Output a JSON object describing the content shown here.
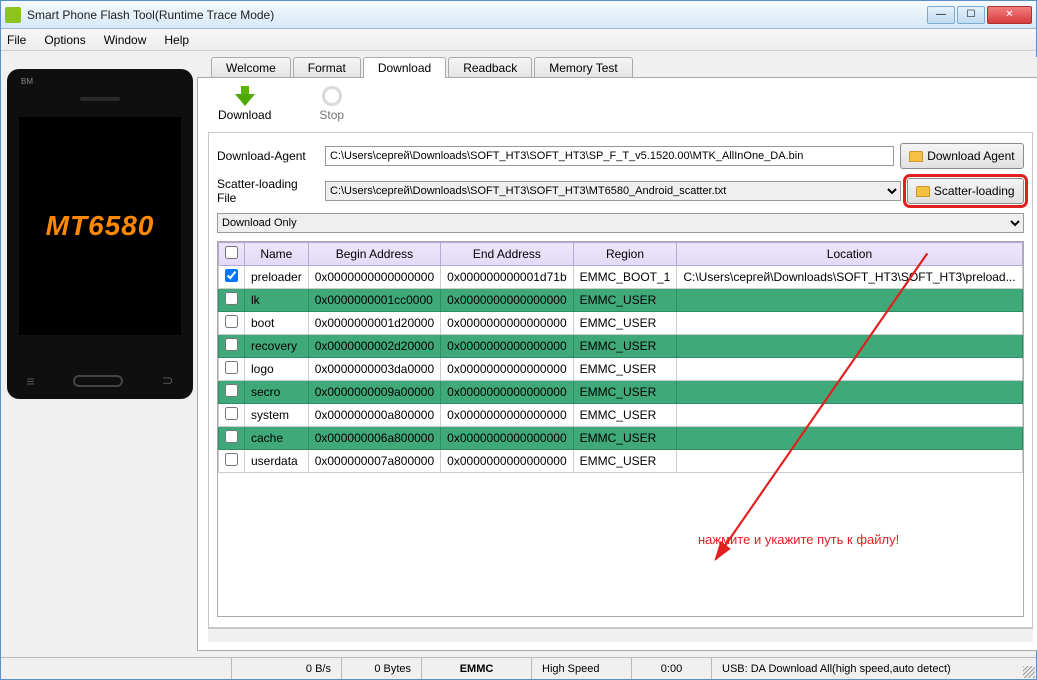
{
  "window": {
    "title": "Smart Phone Flash Tool(Runtime Trace Mode)"
  },
  "menu": {
    "file": "File",
    "options": "Options",
    "window": "Window",
    "help": "Help"
  },
  "phone": {
    "brand": "BM",
    "model": "MT6580"
  },
  "tabs": {
    "welcome": "Welcome",
    "format": "Format",
    "download": "Download",
    "readback": "Readback",
    "memorytest": "Memory Test"
  },
  "toolbar": {
    "download": "Download",
    "stop": "Stop"
  },
  "form": {
    "da_label": "Download-Agent",
    "da_value": "C:\\Users\\сергей\\Downloads\\SOFT_HT3\\SOFT_HT3\\SP_F_T_v5.1520.00\\MTK_AllInOne_DA.bin",
    "da_btn": "Download Agent",
    "scatter_label": "Scatter-loading File",
    "scatter_value": "C:\\Users\\сергей\\Downloads\\SOFT_HT3\\SOFT_HT3\\MT6580_Android_scatter.txt",
    "scatter_btn": "Scatter-loading",
    "mode": "Download Only"
  },
  "table": {
    "headers": {
      "name": "Name",
      "begin": "Begin Address",
      "end": "End Address",
      "region": "Region",
      "location": "Location"
    },
    "rows": [
      {
        "checked": true,
        "sel": false,
        "name": "preloader",
        "begin": "0x0000000000000000",
        "end": "0x000000000001d71b",
        "region": "EMMC_BOOT_1",
        "location": "C:\\Users\\сергей\\Downloads\\SOFT_HT3\\SOFT_HT3\\preload..."
      },
      {
        "checked": false,
        "sel": true,
        "name": "lk",
        "begin": "0x0000000001cc0000",
        "end": "0x0000000000000000",
        "region": "EMMC_USER",
        "location": ""
      },
      {
        "checked": false,
        "sel": false,
        "name": "boot",
        "begin": "0x0000000001d20000",
        "end": "0x0000000000000000",
        "region": "EMMC_USER",
        "location": ""
      },
      {
        "checked": false,
        "sel": true,
        "name": "recovery",
        "begin": "0x0000000002d20000",
        "end": "0x0000000000000000",
        "region": "EMMC_USER",
        "location": ""
      },
      {
        "checked": false,
        "sel": false,
        "name": "logo",
        "begin": "0x0000000003da0000",
        "end": "0x0000000000000000",
        "region": "EMMC_USER",
        "location": ""
      },
      {
        "checked": false,
        "sel": true,
        "name": "secro",
        "begin": "0x0000000009a00000",
        "end": "0x0000000000000000",
        "region": "EMMC_USER",
        "location": ""
      },
      {
        "checked": false,
        "sel": false,
        "name": "system",
        "begin": "0x000000000a800000",
        "end": "0x0000000000000000",
        "region": "EMMC_USER",
        "location": ""
      },
      {
        "checked": false,
        "sel": true,
        "name": "cache",
        "begin": "0x000000006a800000",
        "end": "0x0000000000000000",
        "region": "EMMC_USER",
        "location": ""
      },
      {
        "checked": false,
        "sel": false,
        "name": "userdata",
        "begin": "0x000000007a800000",
        "end": "0x0000000000000000",
        "region": "EMMC_USER",
        "location": ""
      }
    ]
  },
  "annotation": {
    "text": "нажмите и укажите путь к файлу!"
  },
  "status": {
    "speed": "0 B/s",
    "bytes": "0 Bytes",
    "storage": "EMMC",
    "mode": "High Speed",
    "time": "0:00",
    "usb": "USB: DA Download All(high speed,auto detect)"
  }
}
